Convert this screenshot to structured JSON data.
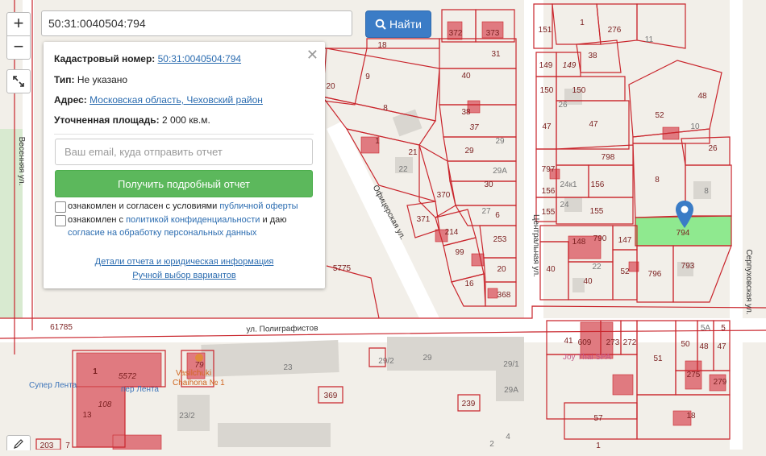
{
  "search": {
    "value": "50:31:0040504:794",
    "button_label": "Найти"
  },
  "controls": {
    "zoom_in": "+",
    "zoom_out": "−"
  },
  "panel": {
    "cadastral_label": "Кадастровый номер:",
    "cadastral_value": "50:31:0040504:794",
    "type_label": "Тип:",
    "type_value": "Не указано",
    "address_label": "Адрес:",
    "address_value": "Московская область, Чеховский район",
    "area_label": "Уточненная площадь:",
    "area_value": "2 000 кв.м.",
    "email_placeholder": "Ваш email, куда отправить отчет",
    "report_button": "Получить подробный отчет",
    "agree1_prefix": "ознакомлен и согласен с условиями",
    "agree1_link": "публичной оферты",
    "agree2_prefix": "ознакомлен с",
    "agree2_link": "политикой конфиденциальности",
    "agree2_mid": "и даю",
    "agree2_link2": "согласие на обработку персональных данных",
    "details_link": "Детали отчета и юридическая информация",
    "manual_link": "Ручной выбор вариантов"
  },
  "map": {
    "streets": {
      "poligrafistov": "ул. Полиграфистов",
      "oficerskaya": "Офицерская ул.",
      "centralnaya": "Центральная ул.",
      "serpukhovskaya": "Серпуховская ул.",
      "vesennyaya": "Весенняя ул."
    },
    "pois": {
      "lenta1": "Супер Лента",
      "lenta2": "пер Лента",
      "chaihona1": "Vasilchuki",
      "chaihona2": "Chaihona № 1",
      "joythai": "Joy Thai SPA"
    },
    "parcels": {
      "p372": "372",
      "p373": "373",
      "p18a": "18",
      "p31": "31",
      "p40a": "40",
      "p9": "9",
      "p8a": "8",
      "p20": "20",
      "p38a": "38",
      "p37": "37",
      "p1a": "1",
      "p21": "21",
      "p22a": "22",
      "p29a": "29",
      "p29b": "29",
      "p29A": "29А",
      "p370": "370",
      "p30": "30",
      "p27": "27",
      "p6": "6",
      "p371": "371",
      "p214": "214",
      "p99": "99",
      "p253": "253",
      "p20b": "20",
      "p16": "16",
      "p368": "368",
      "p5775": "5775",
      "p151a": "151",
      "p1b": "1",
      "p276": "276",
      "p11": "11",
      "p38b": "38",
      "p149a": "149",
      "p149b": "149",
      "p150a": "150",
      "p150b": "150",
      "p26a": "26",
      "p48": "48",
      "p47a": "47",
      "p47b": "47",
      "p52": "52",
      "p10": "10",
      "p26b": "26",
      "p798": "798",
      "p797": "797",
      "p24k1": "24к1",
      "p156a": "156",
      "p156b": "156",
      "p8b": "8",
      "p8c": "8",
      "p155a": "155",
      "p155b": "155",
      "p24": "24",
      "p794": "794",
      "p148": "148",
      "p790": "790",
      "p147": "147",
      "p40b": "40",
      "p22b": "22",
      "p40c": "40",
      "p52b": "52",
      "p796": "796",
      "p793": "793",
      "p61785": "61785",
      "p23": "23",
      "p29_2": "29/2",
      "p29c": "29",
      "p29_1": "29/1",
      "p29Ab": "29А",
      "p369": "369",
      "p239": "239",
      "p41": "41",
      "p609": "609",
      "p273": "273",
      "p272": "272",
      "p51": "51",
      "p50": "50",
      "p48b": "48",
      "p5A": "5А",
      "p5": "5",
      "p47c": "47",
      "p275": "275",
      "p279": "279",
      "p57": "57",
      "p18b": "18",
      "p1c": "1",
      "p5572": "5572",
      "p79": "79",
      "p108": "108",
      "p13": "13",
      "p23_2": "23/2",
      "p2": "2",
      "p4": "4",
      "p1d": "1",
      "p203": "203",
      "p7": "7"
    }
  },
  "colors": {
    "parcel_stroke": "#c9252c",
    "highlight": "#8fe98f",
    "accent": "#3b7cc6",
    "report_btn": "#5cb85c"
  }
}
